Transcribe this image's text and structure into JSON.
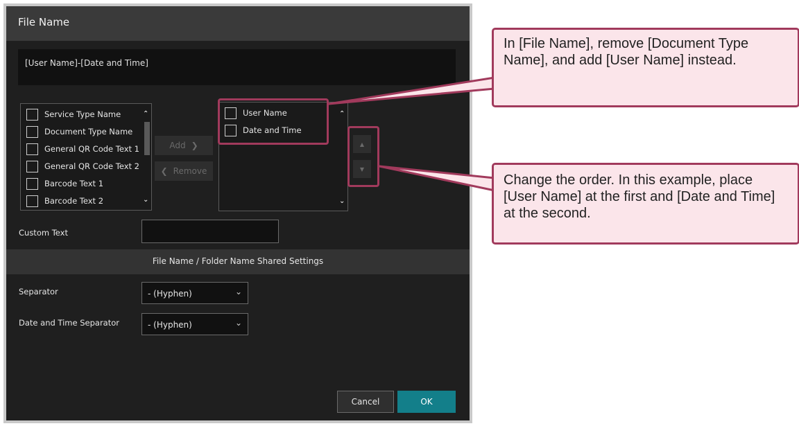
{
  "dialog": {
    "title": "File Name",
    "filename_preview": "[User Name]-[Date and Time]",
    "available_items": [
      "Service Type Name",
      "Document Type Name",
      "General QR Code Text 1",
      "General QR Code Text 2",
      "Barcode Text 1",
      "Barcode Text 2"
    ],
    "selected_items": [
      "User Name",
      "Date and Time"
    ],
    "add_label": "Add",
    "add_icon": "chevron-right-icon",
    "remove_label": "Remove",
    "remove_icon": "chevron-left-icon",
    "move_up_icon": "triangle-up-icon",
    "move_down_icon": "triangle-down-icon",
    "custom_text_label": "Custom Text",
    "custom_text_value": "",
    "shared_settings_header": "File Name / Folder Name Shared Settings",
    "separator_label": "Separator",
    "separator_value": "- (Hyphen)",
    "datetime_separator_label": "Date and Time Separator",
    "datetime_separator_value": "- (Hyphen)",
    "cancel_label": "Cancel",
    "ok_label": "OK"
  },
  "callouts": {
    "top": "In [File Name], remove [Document Type Name], and add [User Name] instead.",
    "bottom": "Change the order. In this example, place [User Name] at the first and [Date and Time] at the second."
  },
  "colors": {
    "dialog_bg": "#1f1f1f",
    "title_bar": "#3a3a3a",
    "accent_ok": "#137f8a",
    "callout_border": "#a13a5c",
    "callout_fill": "#fbe5ea"
  }
}
